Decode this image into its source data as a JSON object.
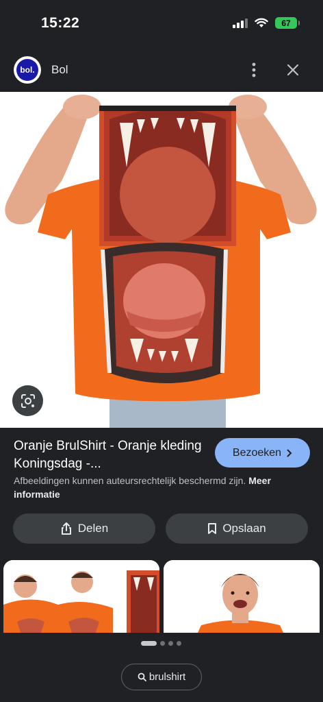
{
  "status_bar": {
    "time": "15:22",
    "battery": "67"
  },
  "header": {
    "site_name": "Bol",
    "logo_text": "bol."
  },
  "result": {
    "title": "Oranje BrulShirt - Oranje kleding Koningsdag -...",
    "visit_label": "Bezoeken",
    "copyright_text": "Afbeeldingen kunnen auteursrechtelijk beschermd zijn.",
    "more_info_link": "Meer informatie"
  },
  "actions": {
    "share_label": "Delen",
    "save_label": "Opslaan"
  },
  "search_chip": {
    "query": "brulshirt"
  },
  "icons": {
    "more": "more-vert-icon",
    "close": "close-icon",
    "lens": "lens-icon",
    "share": "share-icon",
    "bookmark": "bookmark-icon",
    "chevron": "chevron-right-icon",
    "search": "search-icon"
  },
  "colors": {
    "accent": "#8ab4f8",
    "background": "#202124",
    "button": "#3c4043",
    "shirt": "#f26a1b"
  }
}
